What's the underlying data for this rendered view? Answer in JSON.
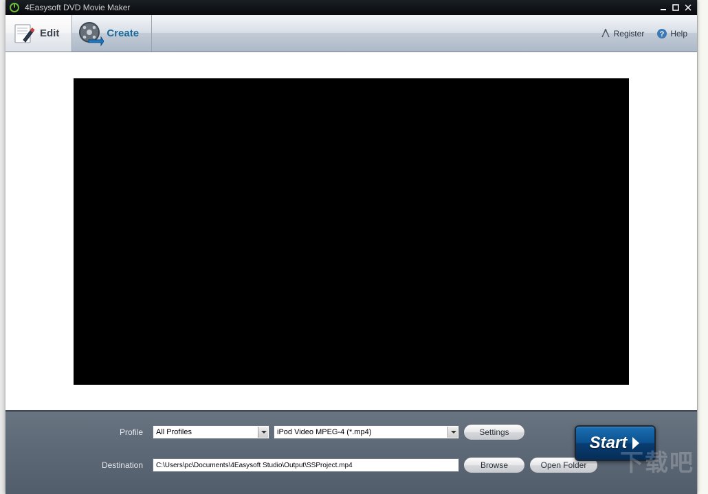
{
  "titlebar": {
    "title": "4Easysoft DVD Movie Maker"
  },
  "tabs": {
    "edit_label": "Edit",
    "create_label": "Create"
  },
  "toolbar": {
    "register_label": "Register",
    "help_label": "Help"
  },
  "form": {
    "profile_label": "Profile",
    "profile_group_value": "All Profiles",
    "profile_format_value": "iPod Video MPEG-4 (*.mp4)",
    "settings_label": "Settings",
    "destination_label": "Destination",
    "destination_value": "C:\\Users\\pc\\Documents\\4Easysoft Studio\\Output\\SSProject.mp4",
    "browse_label": "Browse",
    "open_folder_label": "Open Folder"
  },
  "start": {
    "label": "Start"
  },
  "watermark": "下载吧"
}
